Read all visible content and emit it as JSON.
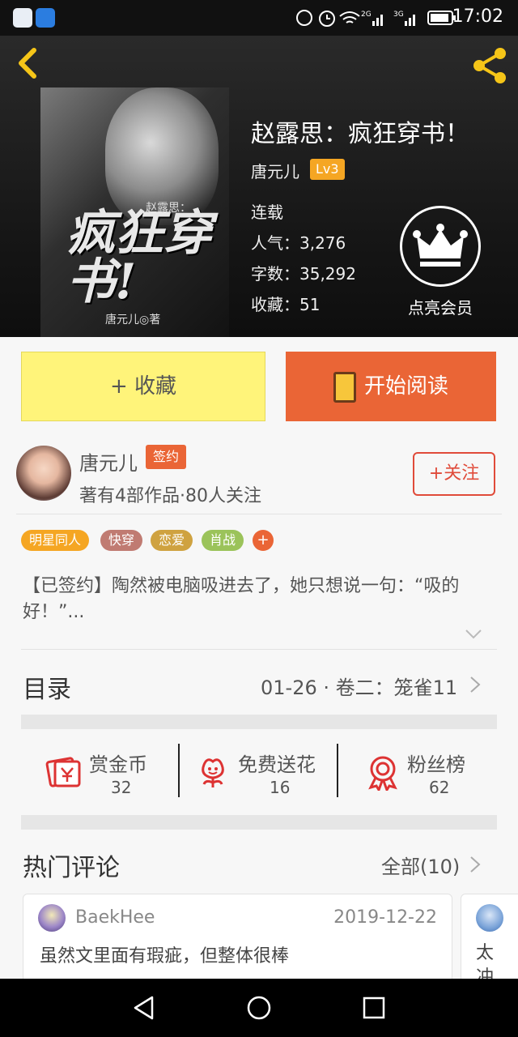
{
  "status_bar": {
    "time": "17:02",
    "network_1": "2G",
    "network_2": "3G"
  },
  "header": {
    "title": "赵露思：疯狂穿书！",
    "author": "唐元儿",
    "author_level": "Lv3",
    "status": "连载",
    "popularity": "人气：3,276",
    "word_count": "字数：35,292",
    "favorites": "收藏：51",
    "vip_label": "点亮会员",
    "cover": {
      "subtitle": "赵露思：",
      "big_title": "疯狂穿书!",
      "author_tag": "唐元儿◎著"
    }
  },
  "actions": {
    "favorite_label": "+ 收藏",
    "read_label": "开始阅读"
  },
  "author": {
    "name": "唐元儿",
    "badge": "签约",
    "stats": "著有4部作品·80人关注",
    "follow_label": "+关注"
  },
  "tags": [
    {
      "label": "明星同人",
      "color": "#f5a623"
    },
    {
      "label": "快穿",
      "color": "#c07b72"
    },
    {
      "label": "恋爱",
      "color": "#cfa240"
    },
    {
      "label": "肖战",
      "color": "#9bc35a"
    }
  ],
  "tag_add": "+",
  "synopsis": "【已签约】陶然被电脑吸进去了，她只想说一句：“吸的好！”...",
  "catalog": {
    "title": "目录",
    "latest": "01-26 · 卷二：笼雀11"
  },
  "stats": [
    {
      "label": "赏金币",
      "value": "32",
      "icon": "reward-coin-icon"
    },
    {
      "label": "免费送花",
      "value": "16",
      "icon": "flower-icon"
    },
    {
      "label": "粉丝榜",
      "value": "62",
      "icon": "medal-icon"
    }
  ],
  "comments": {
    "title": "热门评论",
    "all_label": "全部(10)",
    "items": [
      {
        "user": "BaekHee",
        "date": "2019-12-22",
        "text": "虽然文里面有瑕疵，但整体很棒"
      },
      {
        "text": "太\n冲"
      }
    ]
  },
  "colors": {
    "accent": "#ea6536",
    "favorite_bg": "#fff47a",
    "level_badge": "#f5a623",
    "follow": "#e04b3a"
  }
}
